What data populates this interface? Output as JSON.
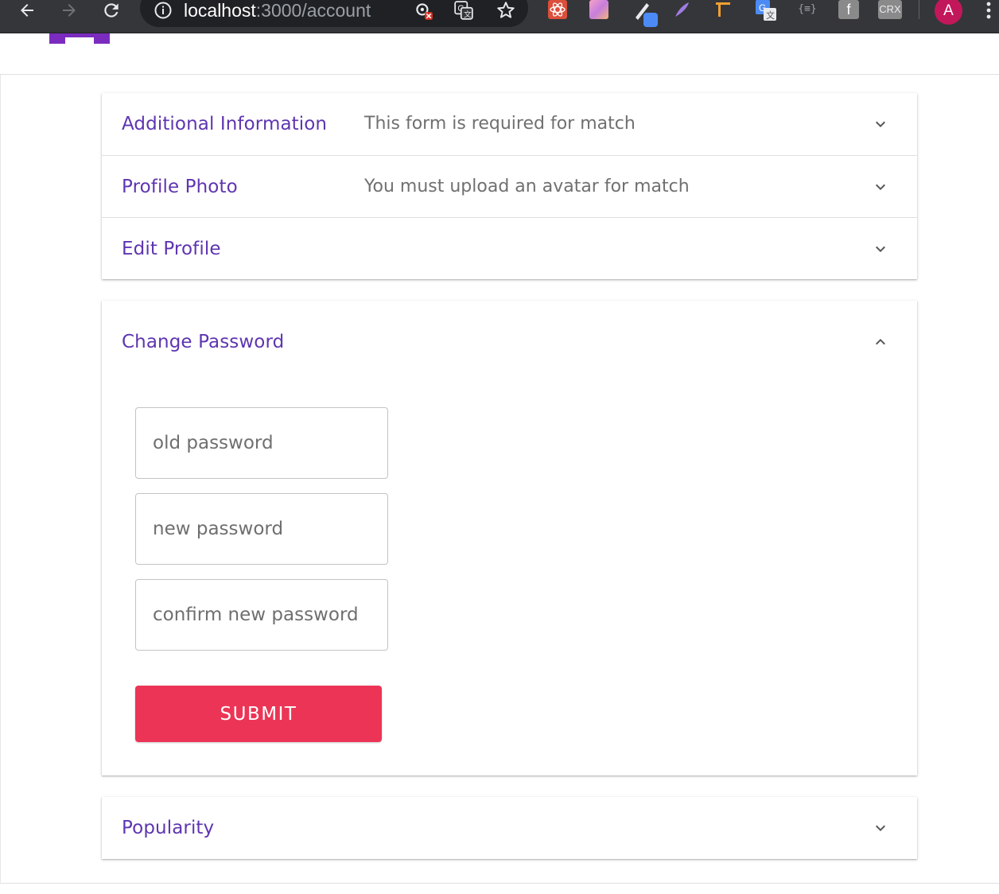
{
  "browser": {
    "url_host": "localhost",
    "url_path": ":3000/account",
    "profile_initial": "A",
    "extensions": [
      {
        "name": "react-devtools-icon",
        "color": "#db4f3b"
      },
      {
        "name": "color-picker-icon",
        "color": "#e07bd0"
      },
      {
        "name": "eyedropper-icon",
        "color": "#4c8bf5"
      },
      {
        "name": "feather-icon",
        "color": "#a07ce0"
      },
      {
        "name": "ruler-icon",
        "color": "#f0a030"
      },
      {
        "name": "google-translate-icon",
        "color": "#4c8bf5"
      },
      {
        "name": "json-formatter-icon",
        "color": "#9aa0a6"
      },
      {
        "name": "facebook-icon",
        "color": "#8a8a8a"
      },
      {
        "name": "crx-icon",
        "color": "#8a8a8a"
      }
    ],
    "json_label": "{≡}",
    "fb_label": "f",
    "crx_label": "CRX"
  },
  "brand": {
    "logo_color": "#7b2cbf"
  },
  "accordion": {
    "additional": {
      "title": "Additional Information",
      "subtitle": "This form is required for match"
    },
    "photo": {
      "title": "Profile Photo",
      "subtitle": "You must upload an avatar for match"
    },
    "edit": {
      "title": "Edit Profile"
    },
    "password": {
      "title": "Change Password",
      "old_placeholder": "old password",
      "new_placeholder": "new password",
      "confirm_placeholder": "confirm new password",
      "submit_label": "Submit"
    },
    "popularity": {
      "title": "Popularity"
    }
  },
  "colors": {
    "accent": "#5e35b1",
    "submit": "#ec3556"
  }
}
